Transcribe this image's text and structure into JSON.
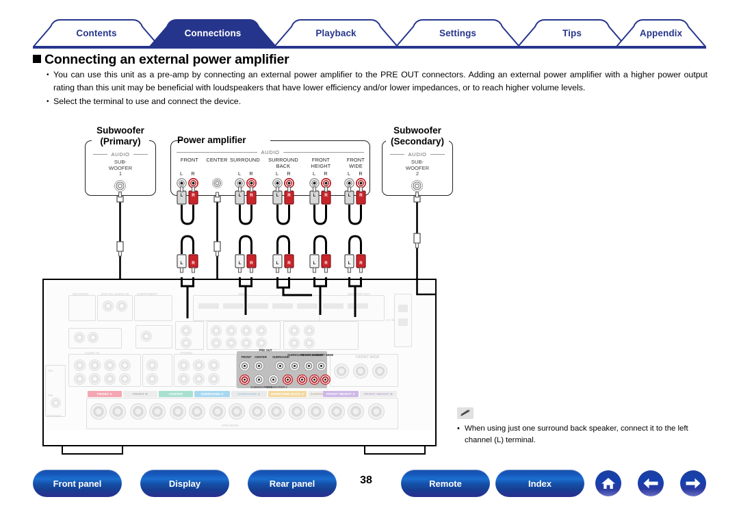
{
  "tabs": [
    {
      "label": "Contents",
      "active": false
    },
    {
      "label": "Connections",
      "active": true
    },
    {
      "label": "Playback",
      "active": false
    },
    {
      "label": "Settings",
      "active": false
    },
    {
      "label": "Tips",
      "active": false
    },
    {
      "label": "Appendix",
      "active": false
    }
  ],
  "heading": "Connecting an external power amplifier",
  "bullets": [
    "You can use this unit as a pre-amp by connecting an external power amplifier to the PRE OUT connectors. Adding an external power amplifier with a higher power output rating than this unit may be beneficial with loudspeakers that have lower efficiency and/or lower impedances, or to reach higher volume levels.",
    "Select the terminal to use and connect the device."
  ],
  "diagram": {
    "subwoofer_primary": {
      "title_line1": "Subwoofer",
      "title_line2": "(Primary)",
      "audio_label": "AUDIO",
      "jack_label_line1": "SUB-",
      "jack_label_line2": "WOOFER",
      "jack_label_line3": "1"
    },
    "subwoofer_secondary": {
      "title_line1": "Subwoofer",
      "title_line2": "(Secondary)",
      "audio_label": "AUDIO",
      "jack_label_line1": "SUB-",
      "jack_label_line2": "WOOFER",
      "jack_label_line3": "2"
    },
    "power_amplifier": {
      "title": "Power amplifier",
      "audio_label": "AUDIO",
      "channels": [
        {
          "name_line1": "FRONT",
          "name_line2": "",
          "left": "L",
          "right": "R",
          "stereo": true
        },
        {
          "name_line1": "CENTER",
          "name_line2": "",
          "left": "",
          "right": "",
          "stereo": false
        },
        {
          "name_line1": "SURROUND",
          "name_line2": "",
          "left": "L",
          "right": "R",
          "stereo": true
        },
        {
          "name_line1": "SURROUND",
          "name_line2": "BACK",
          "left": "L",
          "right": "R",
          "stereo": true
        },
        {
          "name_line1": "FRONT",
          "name_line2": "HEIGHT",
          "left": "L",
          "right": "R",
          "stereo": true
        },
        {
          "name_line1": "FRONT",
          "name_line2": "WIDE",
          "left": "L",
          "right": "R",
          "stereo": true
        }
      ]
    },
    "receiver": {
      "preout_label": "PRE OUT",
      "preout_channels": [
        "FRONT",
        "CENTER",
        "SURROUND",
        "SURROUND BACK",
        "FRONT HEIGHT",
        "FRONT WIDE"
      ],
      "preout_sub_labels": [
        "SUBWOOFER 1",
        "SUBWOOFER 2"
      ],
      "speaker_bands": [
        {
          "label": "FRONT A",
          "color": "#f4a7b3"
        },
        {
          "label": "FRONT B",
          "color": "#ededed"
        },
        {
          "label": "CENTER",
          "color": "#a8e0cf"
        },
        {
          "label": "SURROUND A",
          "color": "#a8d8f0"
        },
        {
          "label": "SURROUND B",
          "color": "#eaeaea"
        },
        {
          "label": "SURROUND BACK A",
          "color": "#f3d9a0"
        },
        {
          "label": "SURROUND BACK B",
          "color": "#ededed"
        },
        {
          "label": "FRONT HEIGHT A",
          "color": "#cdb8e8"
        },
        {
          "label": "FRONT HEIGHT B",
          "color": "#ededed"
        }
      ],
      "front_wide_label": "FRONT WIDE",
      "ghost_labels": [
        "NETWORK",
        "DIGITAL AUDIO IN",
        "COMPONENT VIDEO",
        "HDMI",
        "ANTENNA",
        "SPEAKERS",
        "AC IN",
        "MONITOR OUT"
      ]
    },
    "colors": {
      "jack_red": "#c8252b",
      "jack_white": "#ffffff",
      "cable_black": "#000000",
      "preout_panel": "#bfbfbf"
    }
  },
  "note": {
    "icon": "pencil-icon",
    "text": "When using just one surround back speaker, connect it to the left channel (L) terminal."
  },
  "footer": {
    "buttons": [
      {
        "label": "Front panel"
      },
      {
        "label": "Display"
      },
      {
        "label": "Rear panel"
      }
    ],
    "page_number": "38",
    "buttons_right": [
      {
        "label": "Remote"
      },
      {
        "label": "Index"
      }
    ],
    "icons": [
      {
        "name": "home-icon"
      },
      {
        "name": "arrow-left-icon"
      },
      {
        "name": "arrow-right-icon"
      }
    ]
  }
}
